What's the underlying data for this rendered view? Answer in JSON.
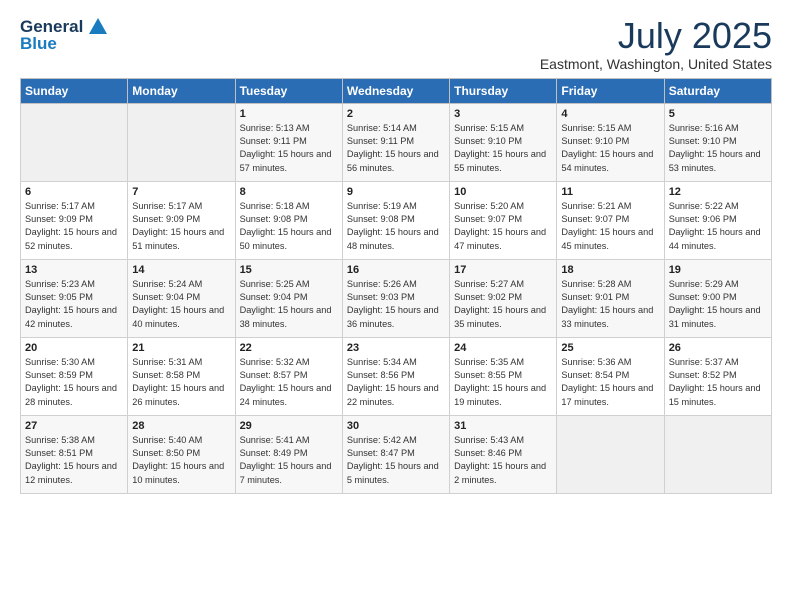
{
  "header": {
    "logo_general": "General",
    "logo_blue": "Blue",
    "title": "July 2025",
    "location": "Eastmont, Washington, United States"
  },
  "days_of_week": [
    "Sunday",
    "Monday",
    "Tuesday",
    "Wednesday",
    "Thursday",
    "Friday",
    "Saturday"
  ],
  "weeks": [
    [
      {
        "day": "",
        "text": ""
      },
      {
        "day": "",
        "text": ""
      },
      {
        "day": "1",
        "text": "Sunrise: 5:13 AM\nSunset: 9:11 PM\nDaylight: 15 hours and 57 minutes."
      },
      {
        "day": "2",
        "text": "Sunrise: 5:14 AM\nSunset: 9:11 PM\nDaylight: 15 hours and 56 minutes."
      },
      {
        "day": "3",
        "text": "Sunrise: 5:15 AM\nSunset: 9:10 PM\nDaylight: 15 hours and 55 minutes."
      },
      {
        "day": "4",
        "text": "Sunrise: 5:15 AM\nSunset: 9:10 PM\nDaylight: 15 hours and 54 minutes."
      },
      {
        "day": "5",
        "text": "Sunrise: 5:16 AM\nSunset: 9:10 PM\nDaylight: 15 hours and 53 minutes."
      }
    ],
    [
      {
        "day": "6",
        "text": "Sunrise: 5:17 AM\nSunset: 9:09 PM\nDaylight: 15 hours and 52 minutes."
      },
      {
        "day": "7",
        "text": "Sunrise: 5:17 AM\nSunset: 9:09 PM\nDaylight: 15 hours and 51 minutes."
      },
      {
        "day": "8",
        "text": "Sunrise: 5:18 AM\nSunset: 9:08 PM\nDaylight: 15 hours and 50 minutes."
      },
      {
        "day": "9",
        "text": "Sunrise: 5:19 AM\nSunset: 9:08 PM\nDaylight: 15 hours and 48 minutes."
      },
      {
        "day": "10",
        "text": "Sunrise: 5:20 AM\nSunset: 9:07 PM\nDaylight: 15 hours and 47 minutes."
      },
      {
        "day": "11",
        "text": "Sunrise: 5:21 AM\nSunset: 9:07 PM\nDaylight: 15 hours and 45 minutes."
      },
      {
        "day": "12",
        "text": "Sunrise: 5:22 AM\nSunset: 9:06 PM\nDaylight: 15 hours and 44 minutes."
      }
    ],
    [
      {
        "day": "13",
        "text": "Sunrise: 5:23 AM\nSunset: 9:05 PM\nDaylight: 15 hours and 42 minutes."
      },
      {
        "day": "14",
        "text": "Sunrise: 5:24 AM\nSunset: 9:04 PM\nDaylight: 15 hours and 40 minutes."
      },
      {
        "day": "15",
        "text": "Sunrise: 5:25 AM\nSunset: 9:04 PM\nDaylight: 15 hours and 38 minutes."
      },
      {
        "day": "16",
        "text": "Sunrise: 5:26 AM\nSunset: 9:03 PM\nDaylight: 15 hours and 36 minutes."
      },
      {
        "day": "17",
        "text": "Sunrise: 5:27 AM\nSunset: 9:02 PM\nDaylight: 15 hours and 35 minutes."
      },
      {
        "day": "18",
        "text": "Sunrise: 5:28 AM\nSunset: 9:01 PM\nDaylight: 15 hours and 33 minutes."
      },
      {
        "day": "19",
        "text": "Sunrise: 5:29 AM\nSunset: 9:00 PM\nDaylight: 15 hours and 31 minutes."
      }
    ],
    [
      {
        "day": "20",
        "text": "Sunrise: 5:30 AM\nSunset: 8:59 PM\nDaylight: 15 hours and 28 minutes."
      },
      {
        "day": "21",
        "text": "Sunrise: 5:31 AM\nSunset: 8:58 PM\nDaylight: 15 hours and 26 minutes."
      },
      {
        "day": "22",
        "text": "Sunrise: 5:32 AM\nSunset: 8:57 PM\nDaylight: 15 hours and 24 minutes."
      },
      {
        "day": "23",
        "text": "Sunrise: 5:34 AM\nSunset: 8:56 PM\nDaylight: 15 hours and 22 minutes."
      },
      {
        "day": "24",
        "text": "Sunrise: 5:35 AM\nSunset: 8:55 PM\nDaylight: 15 hours and 19 minutes."
      },
      {
        "day": "25",
        "text": "Sunrise: 5:36 AM\nSunset: 8:54 PM\nDaylight: 15 hours and 17 minutes."
      },
      {
        "day": "26",
        "text": "Sunrise: 5:37 AM\nSunset: 8:52 PM\nDaylight: 15 hours and 15 minutes."
      }
    ],
    [
      {
        "day": "27",
        "text": "Sunrise: 5:38 AM\nSunset: 8:51 PM\nDaylight: 15 hours and 12 minutes."
      },
      {
        "day": "28",
        "text": "Sunrise: 5:40 AM\nSunset: 8:50 PM\nDaylight: 15 hours and 10 minutes."
      },
      {
        "day": "29",
        "text": "Sunrise: 5:41 AM\nSunset: 8:49 PM\nDaylight: 15 hours and 7 minutes."
      },
      {
        "day": "30",
        "text": "Sunrise: 5:42 AM\nSunset: 8:47 PM\nDaylight: 15 hours and 5 minutes."
      },
      {
        "day": "31",
        "text": "Sunrise: 5:43 AM\nSunset: 8:46 PM\nDaylight: 15 hours and 2 minutes."
      },
      {
        "day": "",
        "text": ""
      },
      {
        "day": "",
        "text": ""
      }
    ]
  ]
}
